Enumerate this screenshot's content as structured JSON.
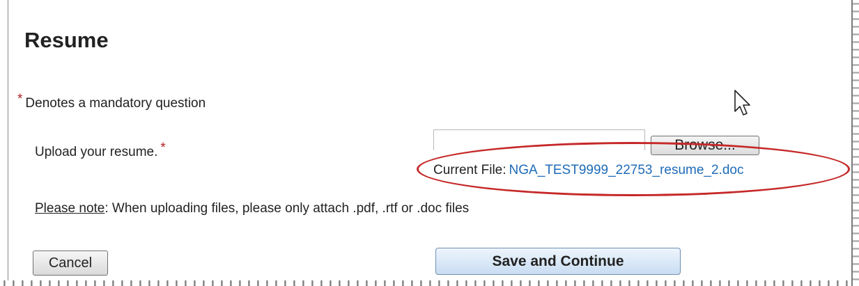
{
  "page": {
    "title": "Resume",
    "mandatory_note": "Denotes a mandatory question",
    "asterisk": "*"
  },
  "upload": {
    "label": "Upload your resume.",
    "file_input_value": "",
    "browse_label": "Browse...",
    "current_file_label": "Current File:",
    "current_file_name": "NGA_TEST9999_22753_resume_2.doc"
  },
  "note": {
    "lead": "Please note",
    "text": ": When uploading files, please only attach .pdf, .rtf or .doc files"
  },
  "actions": {
    "cancel_label": "Cancel",
    "save_label": "Save and Continue"
  },
  "colors": {
    "asterisk": "#b22222",
    "link": "#1e6bb8",
    "highlight": "#c62828"
  },
  "icons": {
    "cursor": "mouse-pointer-icon"
  }
}
